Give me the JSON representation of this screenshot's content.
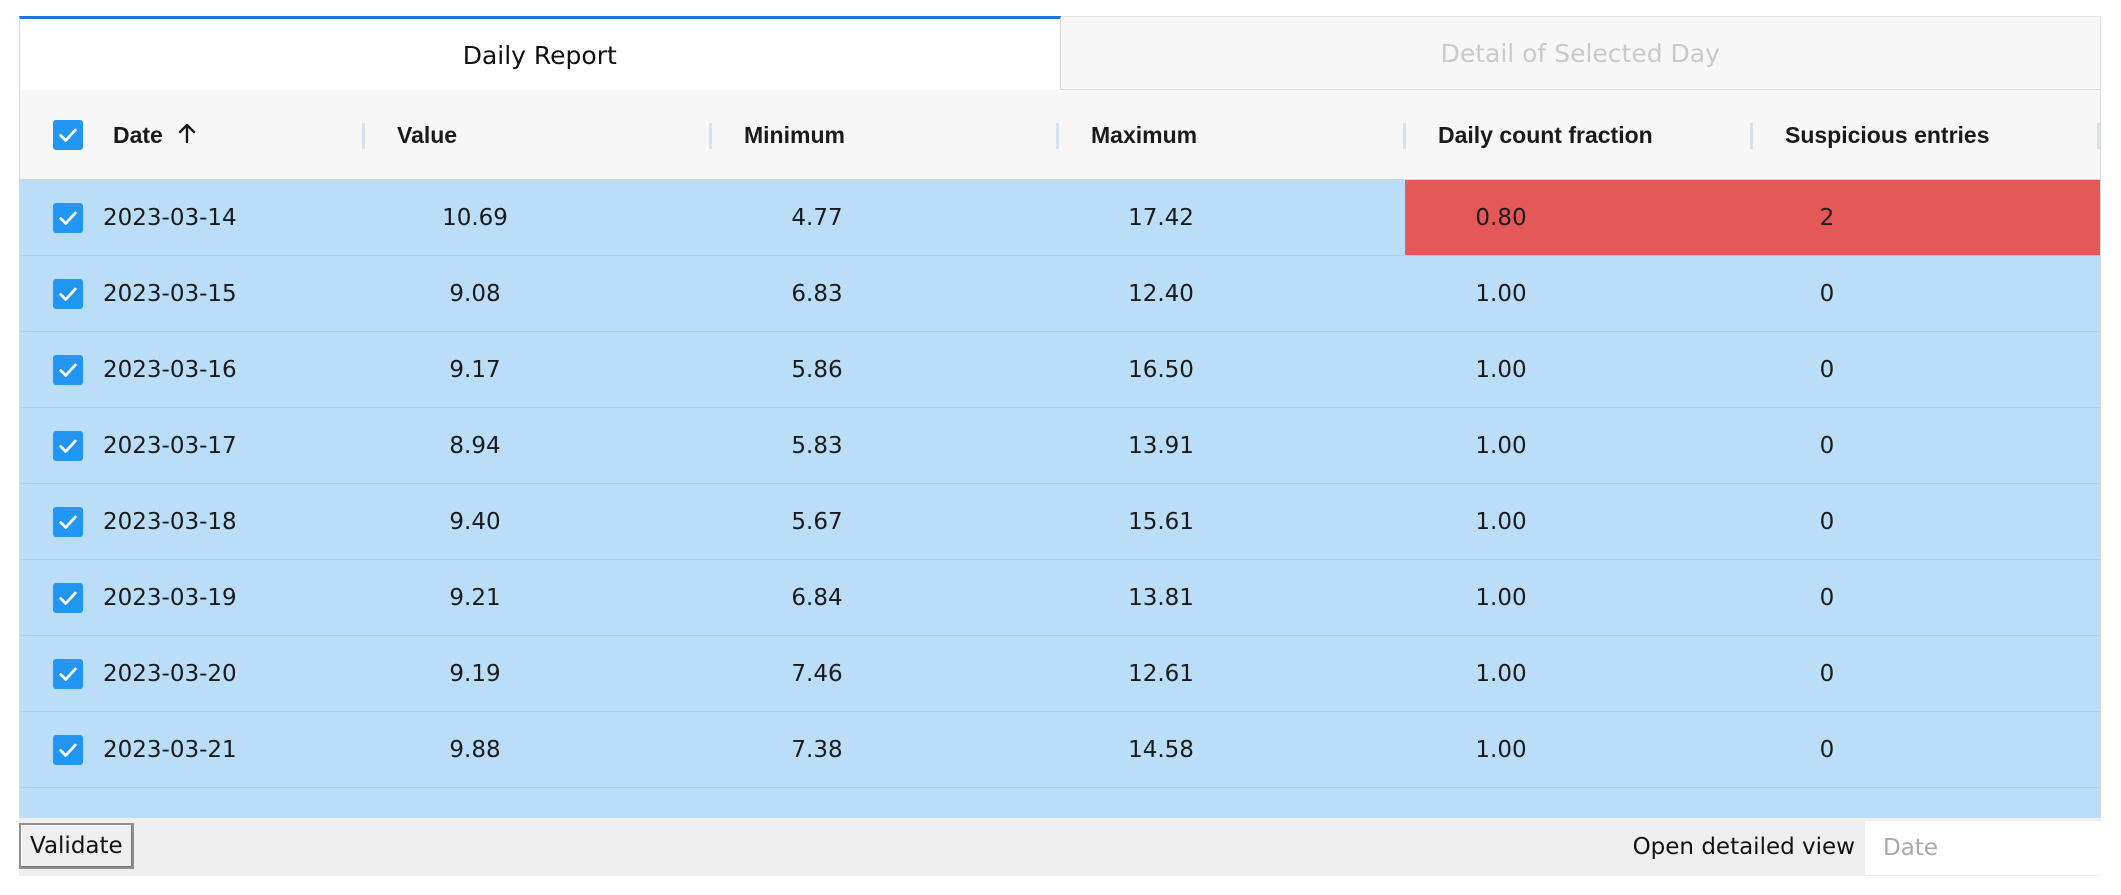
{
  "tabs": [
    {
      "label": "Daily Report",
      "active": true
    },
    {
      "label": "Detail of Selected Day",
      "active": false
    }
  ],
  "table": {
    "columns": [
      {
        "label": "Date",
        "sort": "ascending"
      },
      {
        "label": "Value"
      },
      {
        "label": "Minimum"
      },
      {
        "label": "Maximum"
      },
      {
        "label": "Daily count fraction"
      },
      {
        "label": "Suspicious entries"
      }
    ],
    "header_checked": true,
    "rows": [
      {
        "checked": true,
        "date": "2023-03-14",
        "value": "10.69",
        "minimum": "4.77",
        "maximum": "17.42",
        "fraction": "0.80",
        "suspicious": "2",
        "flagged": true
      },
      {
        "checked": true,
        "date": "2023-03-15",
        "value": "9.08",
        "minimum": "6.83",
        "maximum": "12.40",
        "fraction": "1.00",
        "suspicious": "0",
        "flagged": false
      },
      {
        "checked": true,
        "date": "2023-03-16",
        "value": "9.17",
        "minimum": "5.86",
        "maximum": "16.50",
        "fraction": "1.00",
        "suspicious": "0",
        "flagged": false
      },
      {
        "checked": true,
        "date": "2023-03-17",
        "value": "8.94",
        "minimum": "5.83",
        "maximum": "13.91",
        "fraction": "1.00",
        "suspicious": "0",
        "flagged": false
      },
      {
        "checked": true,
        "date": "2023-03-18",
        "value": "9.40",
        "minimum": "5.67",
        "maximum": "15.61",
        "fraction": "1.00",
        "suspicious": "0",
        "flagged": false
      },
      {
        "checked": true,
        "date": "2023-03-19",
        "value": "9.21",
        "minimum": "6.84",
        "maximum": "13.81",
        "fraction": "1.00",
        "suspicious": "0",
        "flagged": false
      },
      {
        "checked": true,
        "date": "2023-03-20",
        "value": "9.19",
        "minimum": "7.46",
        "maximum": "12.61",
        "fraction": "1.00",
        "suspicious": "0",
        "flagged": false
      },
      {
        "checked": true,
        "date": "2023-03-21",
        "value": "9.88",
        "minimum": "7.38",
        "maximum": "14.58",
        "fraction": "1.00",
        "suspicious": "0",
        "flagged": false
      }
    ],
    "sort_icon": "arrow-up-icon",
    "checkbox_icon": "checkmark-icon"
  },
  "footer": {
    "validate_label": "Validate",
    "open_detail_label": "Open detailed view",
    "date_placeholder": "Date",
    "date_value": ""
  },
  "colors": {
    "selected_row": "#bbdef8",
    "flagged_cells": "#e55858",
    "checkbox": "#2196f3",
    "active_tab_accent": "#1f74d8"
  }
}
